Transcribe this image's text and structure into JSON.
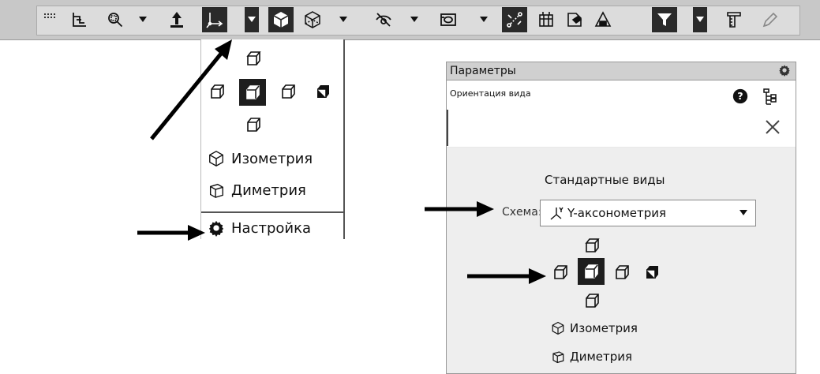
{
  "menu": {
    "izometriya": "Изометрия",
    "dimetriya": "Диметрия",
    "nastroyka": "Настройка"
  },
  "panel": {
    "title": "Параметры",
    "subtitle": "Ориентация вида",
    "section_title": "Стандартные виды",
    "scheme_label": "Схема:",
    "scheme_value": "Y-аксонометрия",
    "izometriya": "Изометрия",
    "dimetriya": "Диметрия"
  },
  "icons": {
    "toolbar": [
      "grip-icon",
      "axes-icon",
      "zoom-icon",
      "chevron-down-icon",
      "rotate-icon",
      "orientation-icon",
      "chevron-down-icon",
      "shaded-cube-icon",
      "wireframe-cube-icon",
      "chevron-down-icon",
      "hide-icon",
      "chevron-down-icon",
      "display-mode-icon",
      "chevron-down-icon",
      "connection-icon",
      "grid-icon",
      "part-icon",
      "assembly-icon",
      "filter-icon",
      "chevron-down-icon",
      "ruler-icon",
      "pencil-icon"
    ]
  }
}
